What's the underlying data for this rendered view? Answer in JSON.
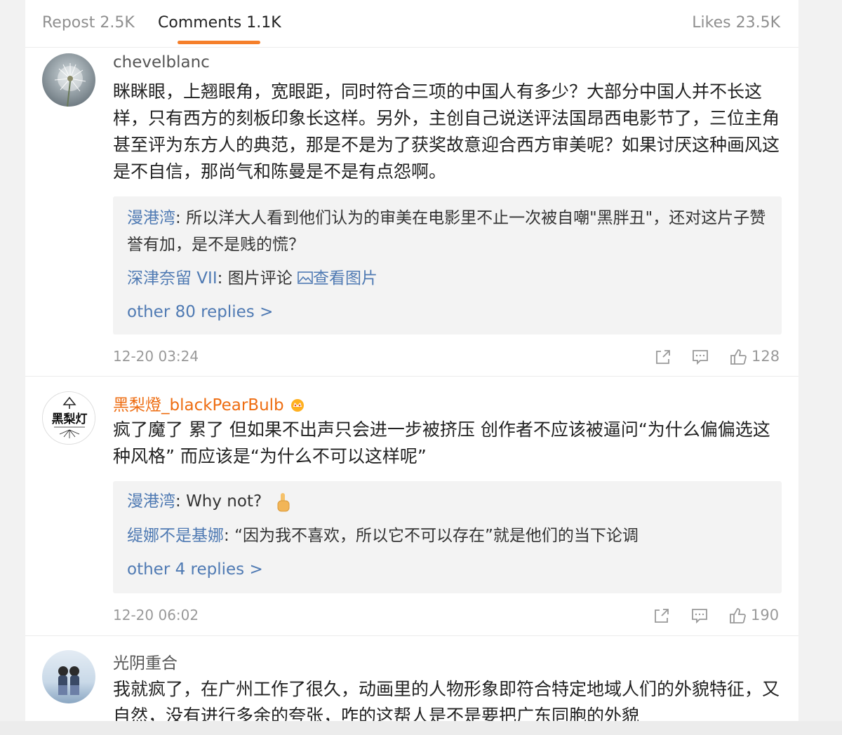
{
  "tabs": {
    "repost": "Repost 2.5K",
    "comments": "Comments 1.1K",
    "likes": "Likes 23.5K"
  },
  "colors": {
    "accent": "#f57f2a",
    "link": "#4f7ab3",
    "vip_name": "#ee6d12"
  },
  "comments": [
    {
      "user": "chevelblanc",
      "text": "眯眯眼，上翘眼角，宽眼距，同时符合三项的中国人有多少？大部分中国人并不长这样，只有西方的刻板印象长这样。另外，主创自己说送评法国昂西电影节了，三位主角甚至评为东方人的典范，那是不是为了获奖故意迎合西方审美呢？如果讨厌这种画风这是不自信，那尚气和陈曼是不是有点怨啊。",
      "replies": [
        {
          "user": "漫港湾",
          "text": "所以洋大人看到他们认为的审美在电影里不止一次被自嘲\"黑胖丑\"，还对这片子赞誉有加，是不是贱的慌？"
        },
        {
          "user": "深津奈留 VII",
          "text": "图片评论",
          "link": "查看图片"
        }
      ],
      "more": "other 80 replies >",
      "time": "12-20 03:24",
      "likes": "128"
    },
    {
      "user": "黑梨燈_blackPearBulb",
      "text": "疯了魔了 累了 但如果不出声只会进一步被挤压 创作者不应该被逼问“为什么偏偏选这种风格” 而应该是“为什么不可以这样呢”",
      "replies": [
        {
          "user": "漫港湾",
          "text": "Why not?"
        },
        {
          "user": "缇娜不是基娜",
          "text": "“因为我不喜欢，所以它不可以存在”就是他们的当下论调"
        }
      ],
      "more": "other 4 replies >",
      "time": "12-20 06:02",
      "likes": "190"
    },
    {
      "user": "光阴重合",
      "text": "我就疯了，在广州工作了很久，动画里的人物形象即符合特定地域人们的外貌特征，又自然，没有进行多余的夸张，咋的这帮人是不是要把广东同胞的外貌"
    }
  ]
}
